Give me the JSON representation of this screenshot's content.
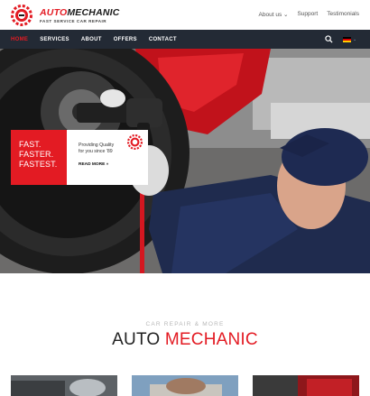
{
  "brand": {
    "name_part1": "AUTO",
    "name_part2": "MECHANIC",
    "tagline": "FAST SERVICE CAR REPAIR",
    "accent": "#e31b23"
  },
  "toplinks": {
    "about": "About us ⌄",
    "support": "Support",
    "testimonials": "Testimonials"
  },
  "nav": {
    "items": [
      "HOME",
      "SERVICES",
      "ABOUT",
      "OFFERS",
      "CONTACT"
    ],
    "active_index": 0,
    "background": "#232a35",
    "search_icon": "search-icon",
    "language_flag": "german-flag-icon",
    "language_caret": "⌄"
  },
  "promo": {
    "line1": "FAST.",
    "line2": "FASTER.",
    "line3": "FASTEST.",
    "desc_line1": "Providing Quality",
    "desc_line2": "for you since '89",
    "read_more": "READ MORE »"
  },
  "section": {
    "kicker": "CAR REPAIR & MORE",
    "title_part1": "AUTO",
    "title_part2": "MECHANIC"
  }
}
